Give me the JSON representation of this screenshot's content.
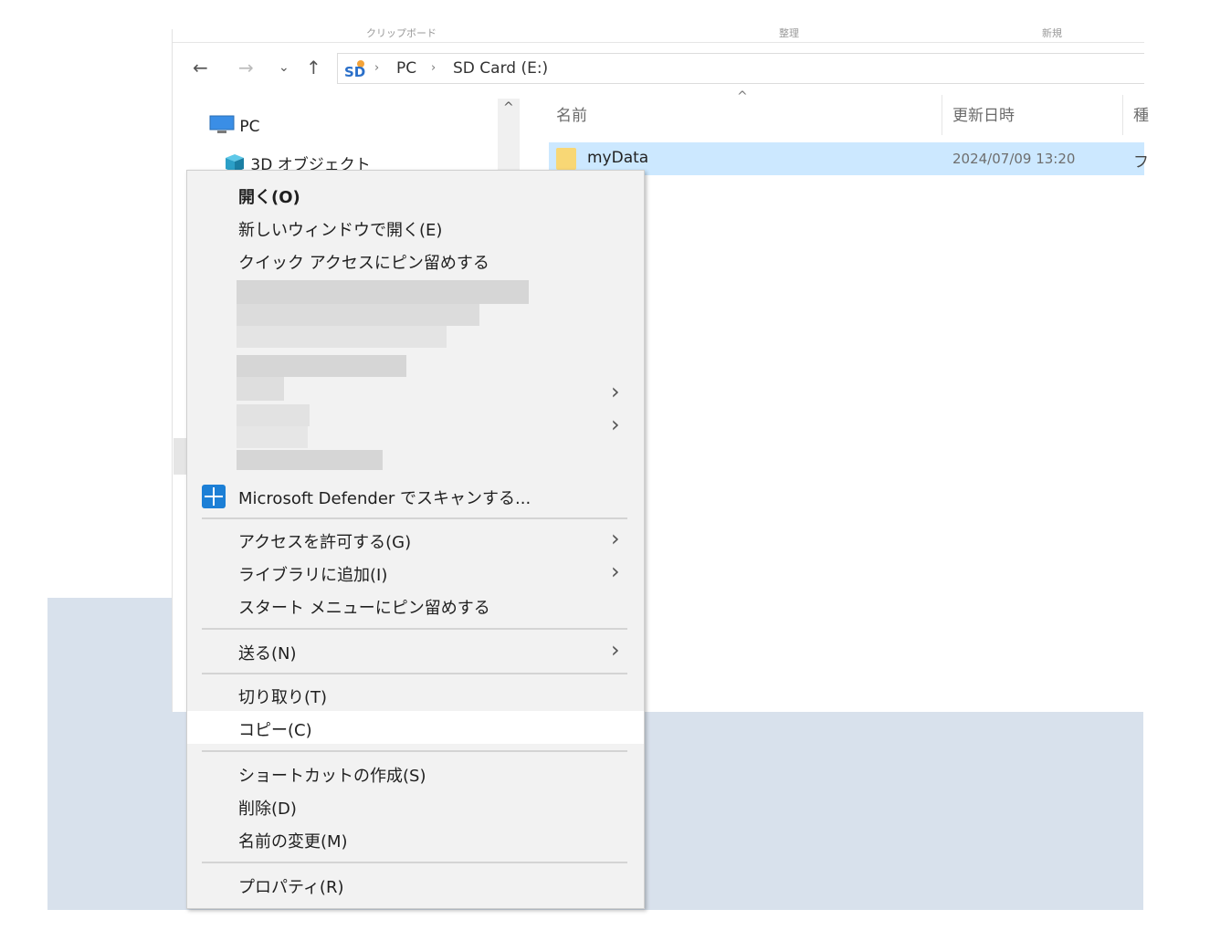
{
  "explorer": {
    "ribbon": {
      "left": "クリップボード",
      "middle": "整理",
      "right": "新規"
    },
    "nav_buttons": {
      "back": "←",
      "forward": "→",
      "recent": "⌄",
      "up": "↑"
    },
    "address": {
      "icon_label": "SD",
      "crumbs": [
        "PC",
        "SD Card (E:)"
      ],
      "sep": "›"
    },
    "nav_pane": {
      "items": [
        {
          "label": "PC",
          "icon": "computer-icon"
        },
        {
          "label": "3D オブジェクト",
          "icon": "3d-objects-icon"
        }
      ],
      "scroll_up": "^"
    },
    "columns": {
      "name": "名前",
      "modified": "更新日時",
      "type": "種",
      "sort_caret": "^"
    },
    "files": [
      {
        "name": "myData",
        "modified": "2024/07/09 13:20",
        "type": "フ",
        "icon": "folder-icon"
      }
    ]
  },
  "context_menu": {
    "open": "開く(O)",
    "open_new_window": "新しいウィンドウで開く(E)",
    "pin_quick_access": "クイック アクセスにピン留めする",
    "defender_scan": "Microsoft Defender でスキャンする...",
    "give_access": "アクセスを許可する(G)",
    "add_to_library": "ライブラリに追加(I)",
    "pin_start": "スタート メニューにピン留めする",
    "send_to": "送る(N)",
    "cut": "切り取り(T)",
    "copy": "コピー(C)",
    "create_shortcut": "ショートカットの作成(S)",
    "delete": "削除(D)",
    "rename": "名前の変更(M)",
    "properties": "プロパティ(R)",
    "submenu_arrow": "›"
  },
  "colors": {
    "selection": "#cce8ff",
    "desktop": "#d8e1ec",
    "menu_bg": "#f2f2f2",
    "defender": "#1c7fd6",
    "folder": "#f8d775"
  }
}
